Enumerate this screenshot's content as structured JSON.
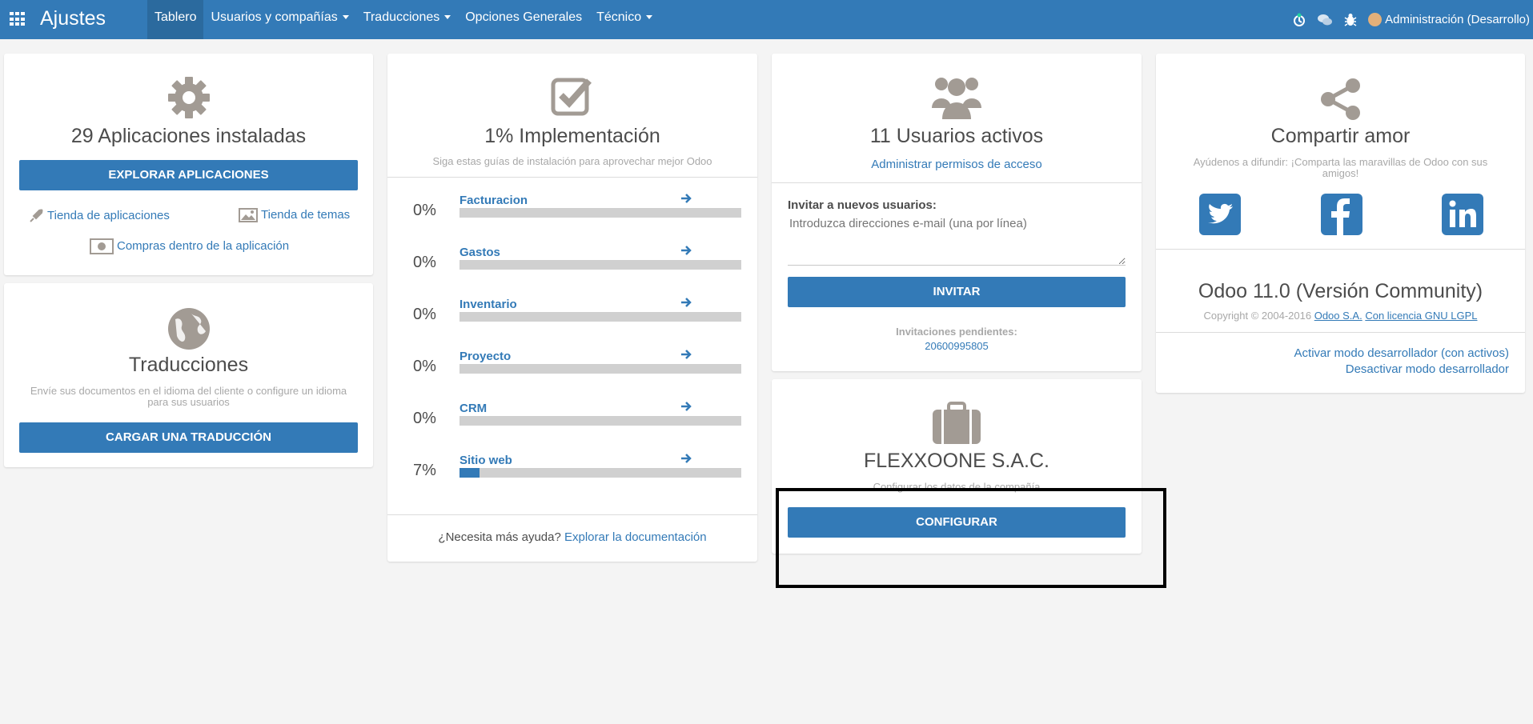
{
  "navbar": {
    "brand": "Ajustes",
    "menu": [
      "Tablero",
      "Usuarios y compañías",
      "Traducciones",
      "Opciones Generales",
      "Técnico"
    ],
    "user": "Administración (Desarrollo)",
    "icons": [
      "apps-icon",
      "activity-icon",
      "chat-icon",
      "bug-icon"
    ],
    "accent_color": "#337ab7"
  },
  "apps": {
    "title": "29 Aplicaciones instaladas",
    "explore_button": "EXPLORAR APLICACIONES",
    "store_link": "Tienda de aplicaciones",
    "themes_link": "Tienda de temas",
    "purchases_link": "Compras dentro de la aplicación"
  },
  "translations": {
    "title": "Traducciones",
    "description": "Envíe sus documentos en el idioma del cliente o configure un idioma para sus usuarios",
    "load_button": "CARGAR UNA TRADUCCIÓN"
  },
  "implementation": {
    "title": "1% Implementación",
    "subtitle": "Siga estas guías de instalación para aprovechar mejor Odoo",
    "items": [
      {
        "pct": "0%",
        "name": "Facturacion",
        "progress": 0
      },
      {
        "pct": "0%",
        "name": "Gastos",
        "progress": 0
      },
      {
        "pct": "0%",
        "name": "Inventario",
        "progress": 0
      },
      {
        "pct": "0%",
        "name": "Proyecto",
        "progress": 0
      },
      {
        "pct": "0%",
        "name": "CRM",
        "progress": 0
      },
      {
        "pct": "7%",
        "name": "Sitio web",
        "progress": 0.07
      }
    ],
    "help_text": "¿Necesita más ayuda?",
    "help_link": "Explorar la documentación"
  },
  "users": {
    "title": "11 Usuarios activos",
    "manage_link": "Administrar permisos de acceso",
    "invite_label": "Invitar a nuevos usuarios:",
    "invite_placeholder": "Introduzca direcciones e-mail (una por línea)",
    "invite_button": "INVITAR",
    "pending_label": "Invitaciones pendientes:",
    "pending_value": "20600995805"
  },
  "company": {
    "name": "FLEXXOONE S.A.C.",
    "description": "Configurar los datos de la compañía",
    "configure_button": "CONFIGURAR"
  },
  "share": {
    "title": "Compartir amor",
    "description": "Ayúdenos a difundir: ¡Comparta las maravillas de Odoo con sus amigos!",
    "social": [
      "twitter-icon",
      "facebook-icon",
      "linkedin-icon"
    ]
  },
  "version": {
    "title": "Odoo 11.0 (Versión Community)",
    "copyright": "Copyright © 2004-2016",
    "company_link": "Odoo S.A.",
    "license_link": "Con licencia GNU LGPL",
    "dev_assets_link": "Activar modo desarrollador (con activos)",
    "dev_off_link": "Desactivar modo desarrollador"
  }
}
